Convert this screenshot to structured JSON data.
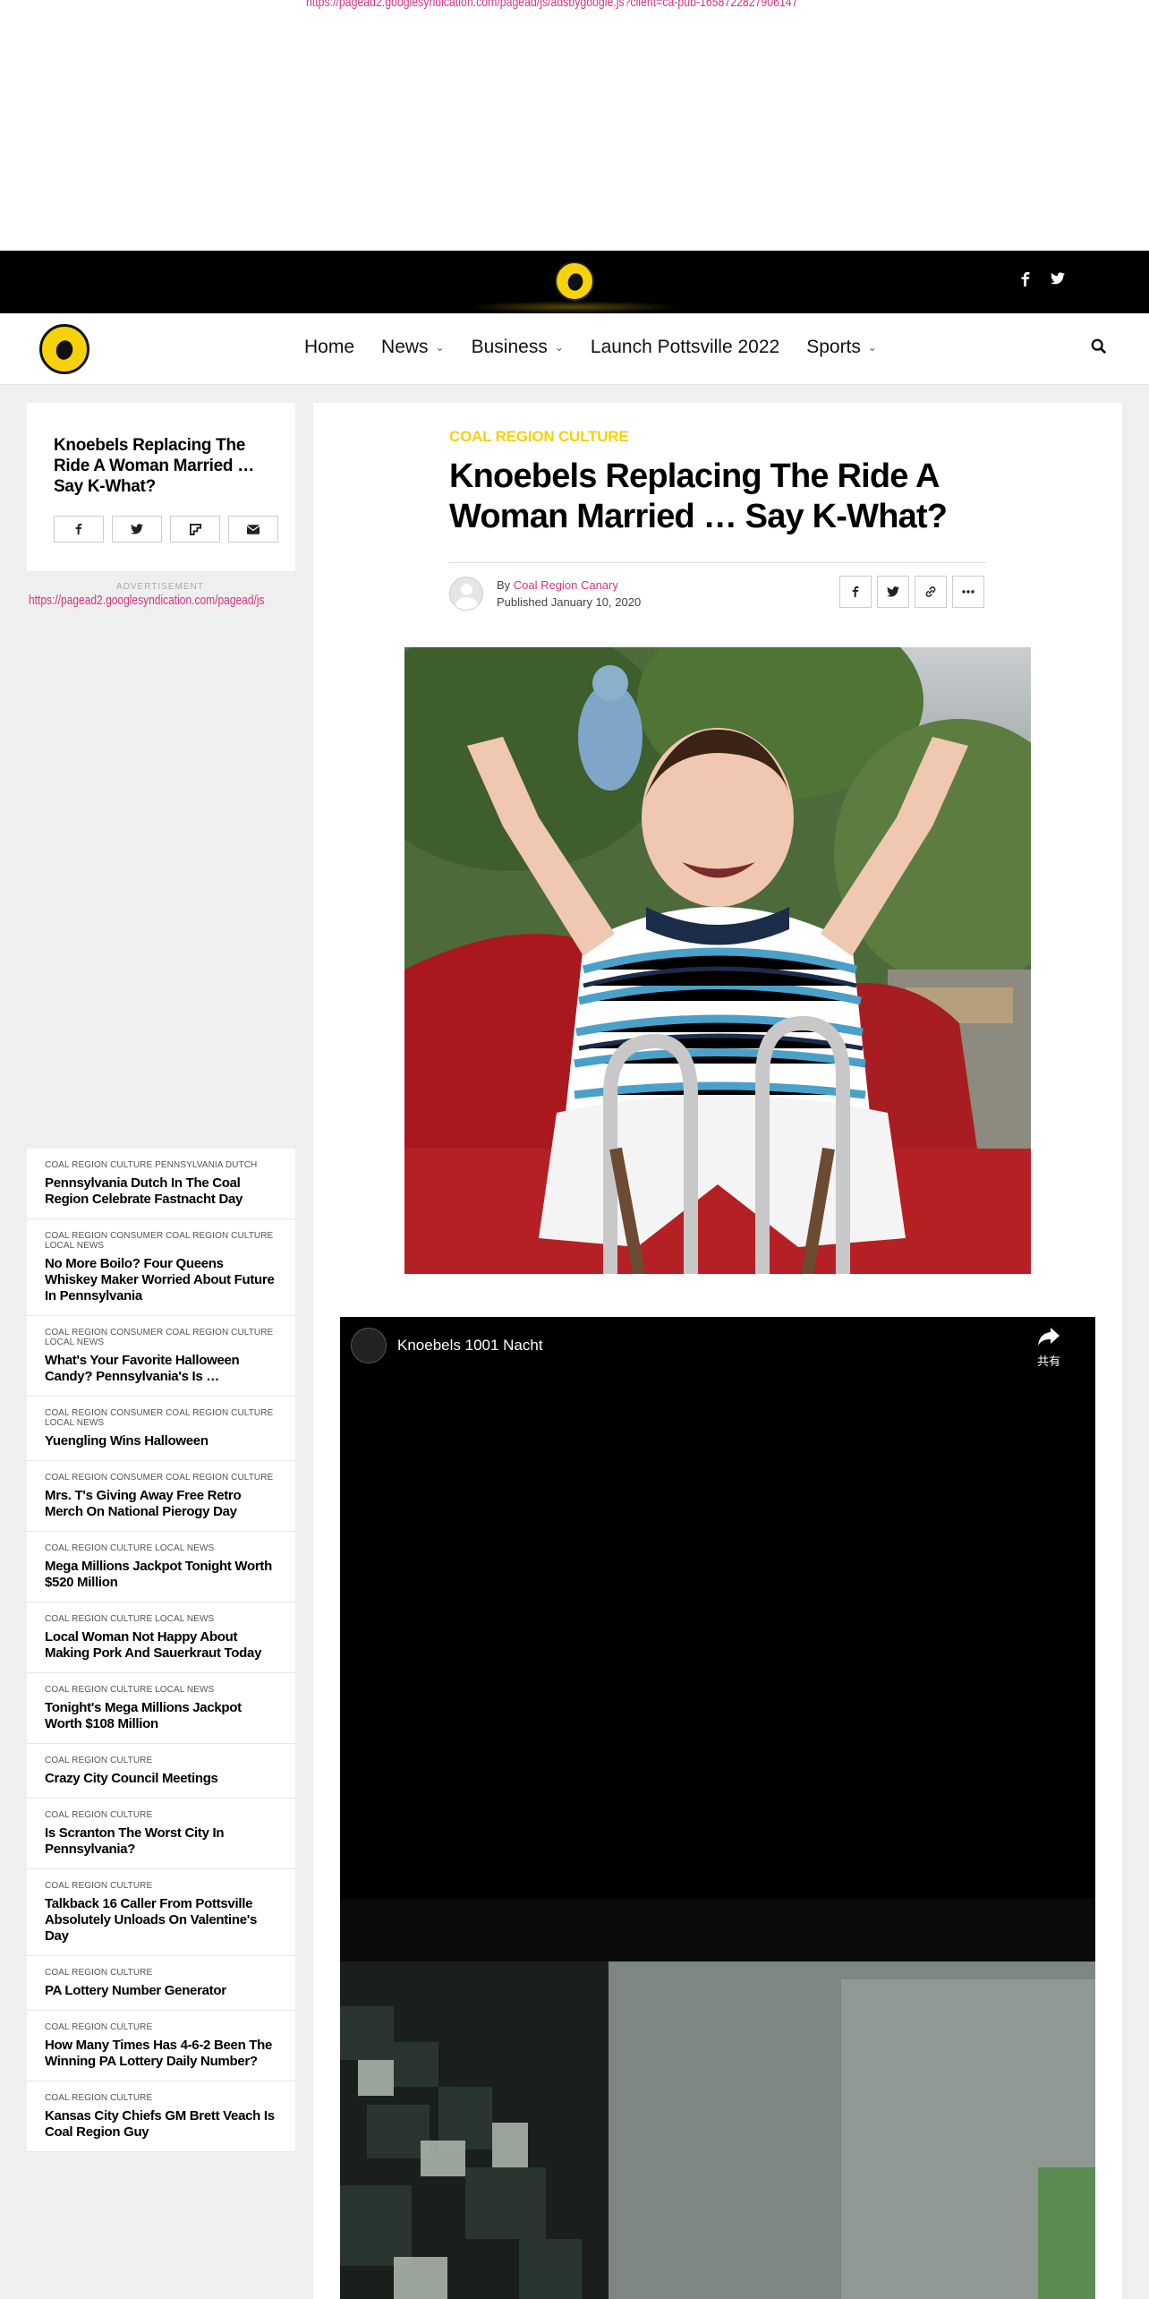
{
  "ad_top": {
    "url": "https://pagead2.googlesyndication.com/pagead/js/adsbygoogle.js?client=ca-pub-1658722827906147"
  },
  "brand": {
    "logo_text": "COAL REGION CANARY"
  },
  "nav": {
    "items": [
      {
        "label": "Home",
        "has_dropdown": false
      },
      {
        "label": "News",
        "has_dropdown": true
      },
      {
        "label": "Business",
        "has_dropdown": true
      },
      {
        "label": "Launch Pottsville 2022",
        "has_dropdown": false
      },
      {
        "label": "Sports",
        "has_dropdown": true
      }
    ]
  },
  "sidebar": {
    "share_title": "Knoebels Replacing The Ride A Woman Married … Say K-What?",
    "ad_label": "ADVERTISEMENT",
    "ad_url": "https://pagead2.googlesyndication.com/pagead/js"
  },
  "related": [
    {
      "cats": "COAL REGION CULTURE PENNSYLVANIA DUTCH",
      "title": "Pennsylvania Dutch In The Coal Region Celebrate Fastnacht Day"
    },
    {
      "cats": "COAL REGION CONSUMER COAL REGION CULTURE LOCAL NEWS",
      "title": "No More Boilo? Four Queens Whiskey Maker Worried About Future In Pennsylvania"
    },
    {
      "cats": "COAL REGION CONSUMER COAL REGION CULTURE LOCAL NEWS",
      "title": "What's Your Favorite Halloween Candy? Pennsylvania's Is …"
    },
    {
      "cats": "COAL REGION CONSUMER COAL REGION CULTURE LOCAL NEWS",
      "title": "Yuengling Wins Halloween"
    },
    {
      "cats": "COAL REGION CONSUMER COAL REGION CULTURE",
      "title": "Mrs. T's Giving Away Free Retro Merch On National Pierogy Day"
    },
    {
      "cats": "COAL REGION CULTURE LOCAL NEWS",
      "title": "Mega Millions Jackpot Tonight Worth $520 Million"
    },
    {
      "cats": "COAL REGION CULTURE LOCAL NEWS",
      "title": "Local Woman Not Happy About Making Pork And Sauerkraut Today"
    },
    {
      "cats": "COAL REGION CULTURE LOCAL NEWS",
      "title": "Tonight's Mega Millions Jackpot Worth $108 Million"
    },
    {
      "cats": "COAL REGION CULTURE",
      "title": "Crazy City Council Meetings"
    },
    {
      "cats": "COAL REGION CULTURE",
      "title": "Is Scranton The Worst City In Pennsylvania?"
    },
    {
      "cats": "COAL REGION CULTURE",
      "title": "Talkback 16 Caller From Pottsville Absolutely Unloads On Valentine's Day"
    },
    {
      "cats": "COAL REGION CULTURE",
      "title": "PA Lottery Number Generator"
    },
    {
      "cats": "COAL REGION CULTURE",
      "title": "How Many Times Has 4-6-2 Been The Winning PA Lottery Daily Number?"
    },
    {
      "cats": "COAL REGION CULTURE",
      "title": "Kansas City Chiefs GM Brett Veach Is Coal Region Guy"
    }
  ],
  "article": {
    "category": "COAL REGION CULTURE",
    "headline": "Knoebels Replacing The Ride A Woman Married … Say K-What?",
    "by": "By",
    "author": "Coal Region Canary",
    "published": "Published January 10, 2020"
  },
  "video": {
    "title": "Knoebels 1001 Nacht",
    "share_label": "共有"
  },
  "colors": {
    "accent_yellow": "#f5d20a",
    "link_pink": "#d63384"
  }
}
